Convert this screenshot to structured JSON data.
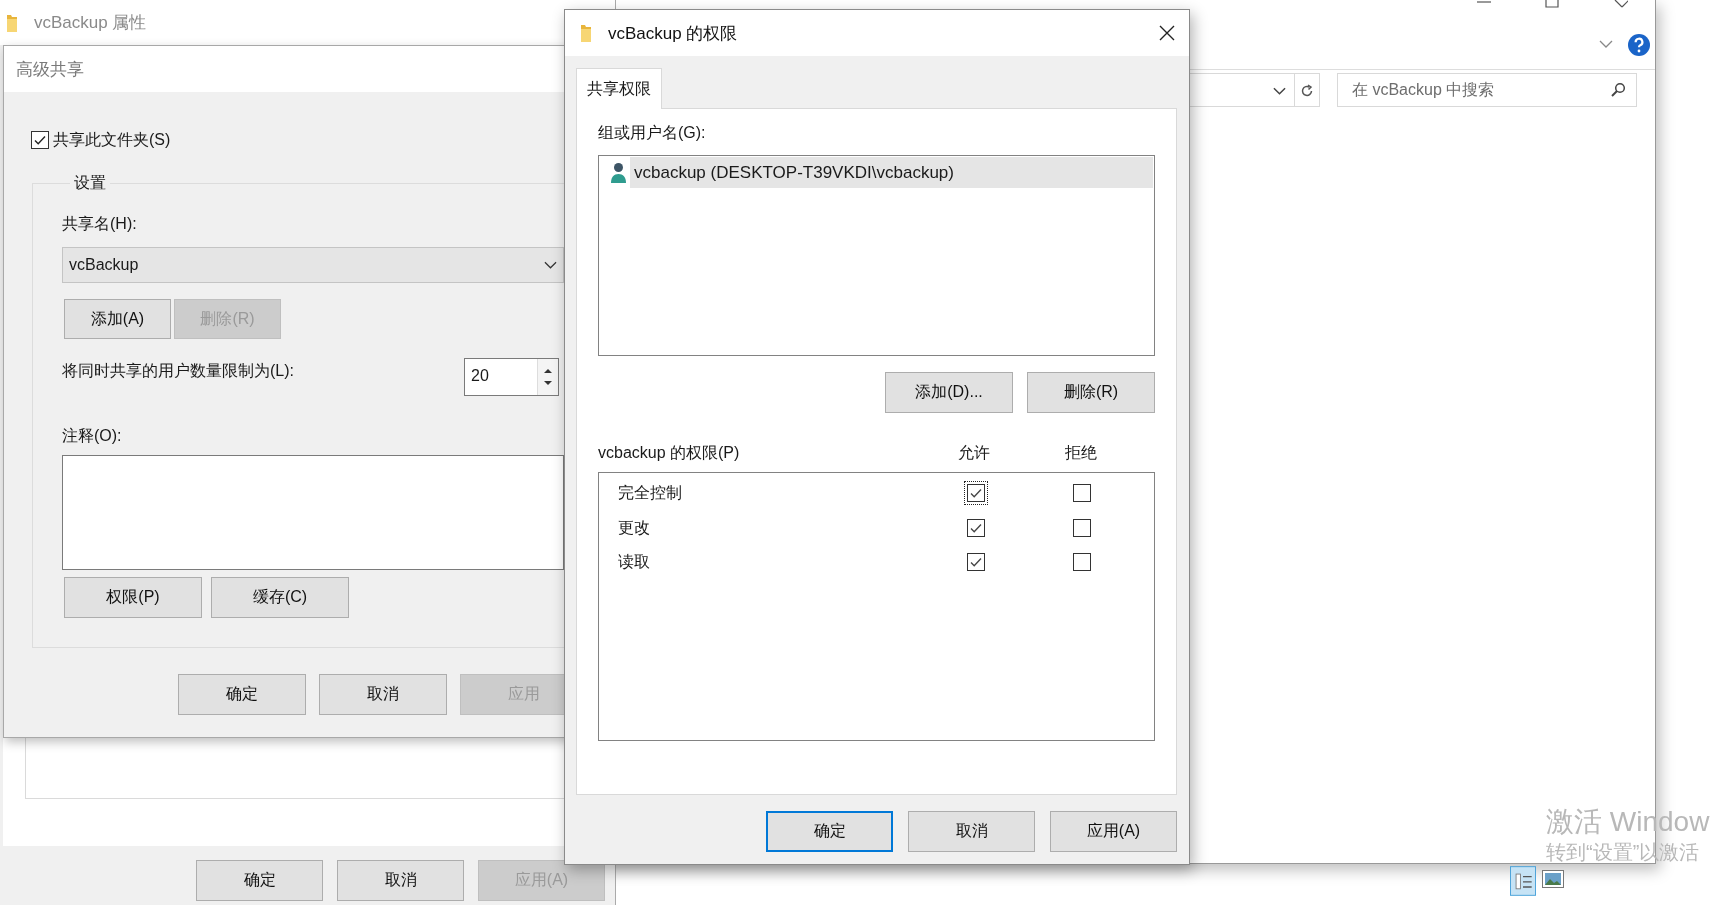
{
  "properties_window": {
    "title": "vcBackup 属性",
    "buttons": [
      {
        "label": "确定",
        "disabled": false
      },
      {
        "label": "取消",
        "disabled": false
      },
      {
        "label": "应用(A)",
        "disabled": true
      }
    ]
  },
  "advanced_sharing": {
    "title": "高级共享",
    "share_checkbox": {
      "label": "共享此文件夹(S)",
      "checked": true
    },
    "group_title": "设置",
    "share_name_label": "共享名(H):",
    "share_name_value": "vcBackup",
    "name_buttons": [
      {
        "label": "添加(A)",
        "disabled": false
      },
      {
        "label": "删除(R)",
        "disabled": true
      }
    ],
    "user_limit_label": "将同时共享的用户数量限制为(L):",
    "user_limit_value": "20",
    "comment_label": "注释(O):",
    "option_buttons": [
      {
        "label": "权限(P)"
      },
      {
        "label": "缓存(C)"
      }
    ],
    "buttons": [
      {
        "label": "确定",
        "disabled": false
      },
      {
        "label": "取消",
        "disabled": false
      },
      {
        "label": "应用",
        "disabled": true
      }
    ]
  },
  "permissions_dialog": {
    "title": "vcBackup 的权限",
    "tabs": [
      {
        "label": "共享权限",
        "selected": true
      }
    ],
    "users_label": "组或用户名(G):",
    "users": [
      {
        "name": "vcbackup (DESKTOP-T39VKDI\\vcbackup)",
        "selected": true
      }
    ],
    "user_buttons": [
      {
        "label": "添加(D)..."
      },
      {
        "label": "删除(R)"
      }
    ],
    "permissions_label": "vcbackup 的权限(P)",
    "columns": [
      "允许",
      "拒绝"
    ],
    "permissions": [
      {
        "name": "完全控制",
        "allow": true,
        "deny": false,
        "focused": true
      },
      {
        "name": "更改",
        "allow": true,
        "deny": false,
        "focused": false
      },
      {
        "name": "读取",
        "allow": true,
        "deny": false,
        "focused": false
      }
    ],
    "buttons": [
      {
        "label": "确定",
        "default": true
      },
      {
        "label": "取消",
        "default": false
      },
      {
        "label": "应用(A)",
        "default": false
      }
    ]
  },
  "explorer": {
    "search_placeholder": "在 vcBackup 中搜索"
  },
  "activation_notice": {
    "title": "激活 Window",
    "subtitle": "转到“设置”以激活"
  }
}
